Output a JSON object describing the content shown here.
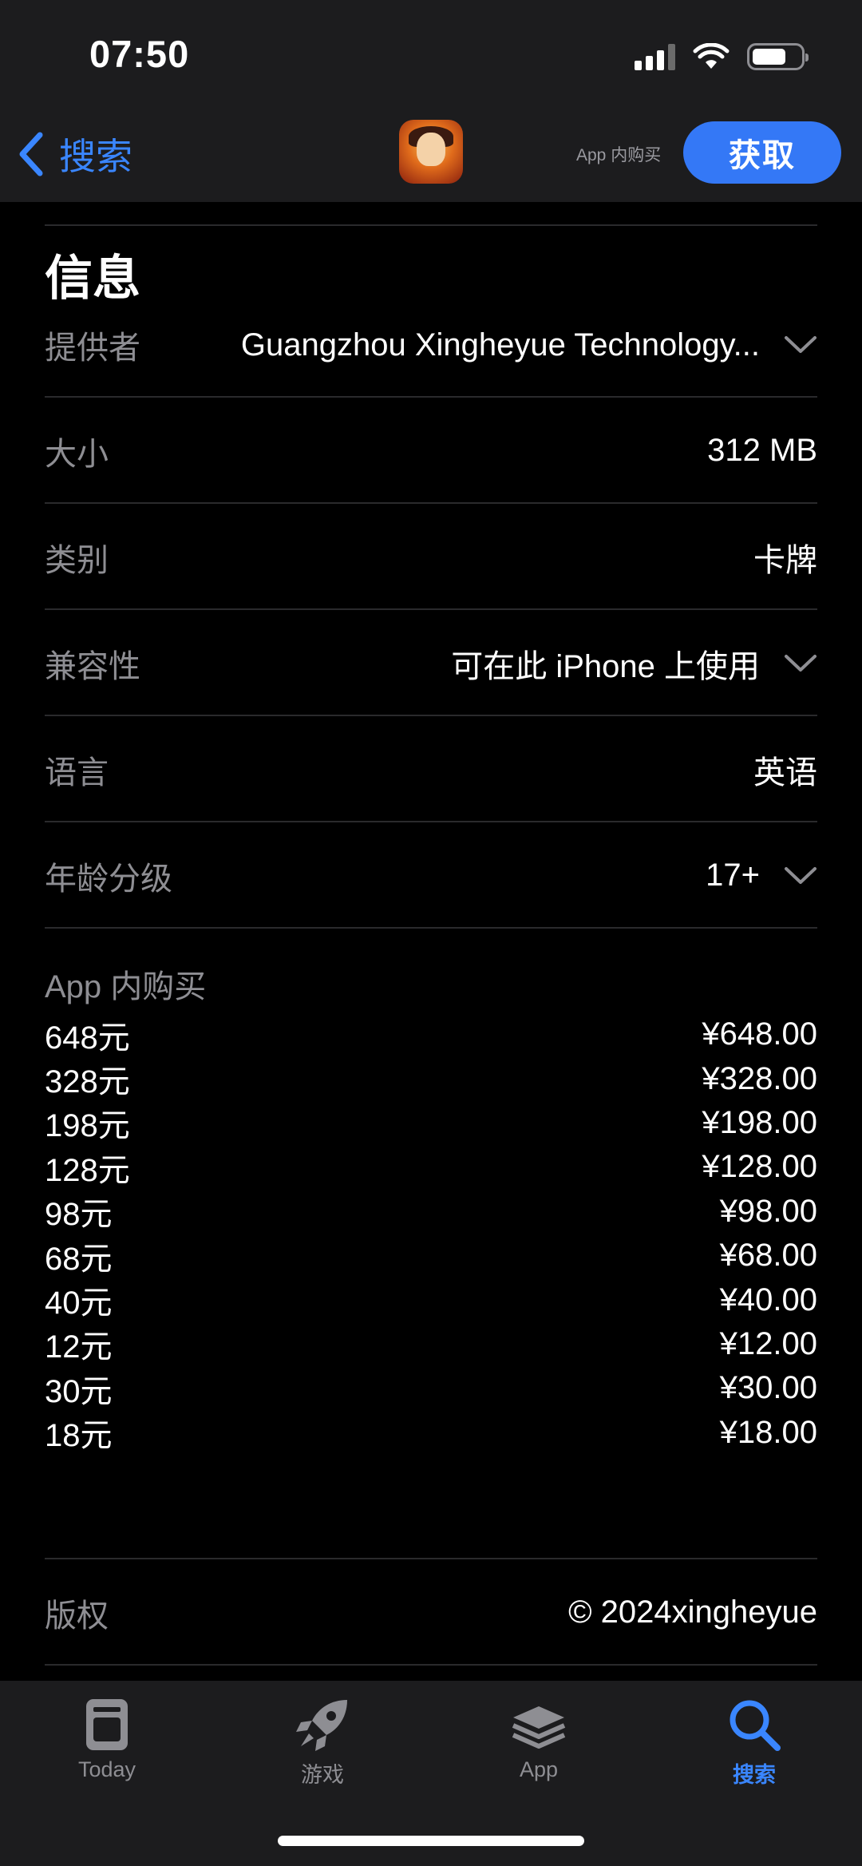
{
  "status": {
    "time": "07:50"
  },
  "nav": {
    "back_label": "搜索",
    "iap_note": "App 内购买",
    "get_label": "获取"
  },
  "info": {
    "title": "信息",
    "provider": {
      "label": "提供者",
      "value": "Guangzhou Xingheyue Technology..."
    },
    "size": {
      "label": "大小",
      "value": "312 MB"
    },
    "category": {
      "label": "类别",
      "value": "卡牌"
    },
    "compatibility": {
      "label": "兼容性",
      "value": "可在此 iPhone 上使用"
    },
    "language": {
      "label": "语言",
      "value": "英语"
    },
    "age": {
      "label": "年龄分级",
      "value": "17+"
    }
  },
  "iap": {
    "label": "App 内购买",
    "items": [
      {
        "name": "648元",
        "price": "¥648.00"
      },
      {
        "name": "328元",
        "price": "¥328.00"
      },
      {
        "name": "198元",
        "price": "¥198.00"
      },
      {
        "name": "128元",
        "price": "¥128.00"
      },
      {
        "name": "98元",
        "price": "¥98.00"
      },
      {
        "name": "68元",
        "price": "¥68.00"
      },
      {
        "name": "40元",
        "price": "¥40.00"
      },
      {
        "name": "12元",
        "price": "¥12.00"
      },
      {
        "name": "30元",
        "price": "¥30.00"
      },
      {
        "name": "18元",
        "price": "¥18.00"
      }
    ]
  },
  "copyright": {
    "label": "版权",
    "value": "© 2024xingheyue"
  },
  "tabs": [
    {
      "label": "Today",
      "icon": "today-icon",
      "active": false
    },
    {
      "label": "游戏",
      "icon": "rocket-icon",
      "active": false
    },
    {
      "label": "App",
      "icon": "layers-icon",
      "active": false
    },
    {
      "label": "搜索",
      "icon": "search-icon",
      "active": true
    }
  ],
  "colors": {
    "accent": "#3478f6",
    "background": "#000000",
    "bar": "#1c1c1e"
  }
}
